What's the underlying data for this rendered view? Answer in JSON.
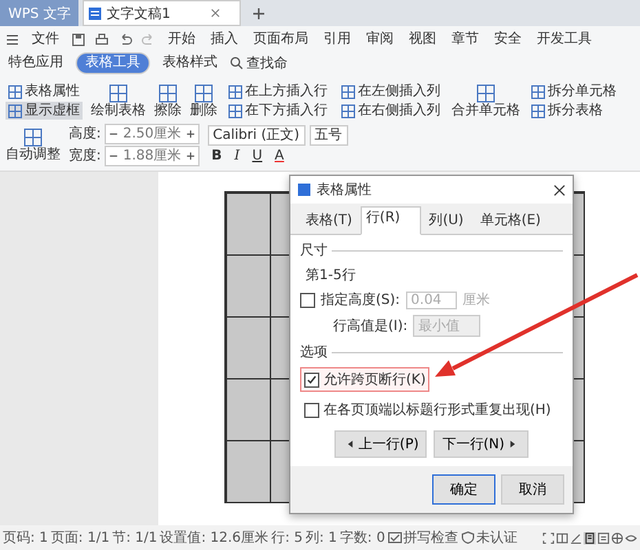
{
  "app_tabs": [
    {
      "label": "WPS 文字",
      "selected": false
    },
    {
      "label": "文字文稿1",
      "selected": true
    }
  ],
  "menu": [
    {
      "label": "文件",
      "selected": false
    },
    {
      "label": "开始",
      "selected": false
    },
    {
      "label": "插入",
      "selected": false
    },
    {
      "label": "页面布局",
      "selected": false
    },
    {
      "label": "引用",
      "selected": false
    },
    {
      "label": "审阅",
      "selected": false
    },
    {
      "label": "视图",
      "selected": false
    },
    {
      "label": "章节",
      "selected": false
    },
    {
      "label": "安全",
      "selected": false
    },
    {
      "label": "开发工具",
      "selected": false
    },
    {
      "label": "特色应用",
      "selected": false
    },
    {
      "label": "表格工具",
      "selected": true
    },
    {
      "label": "表格样式",
      "selected": false
    }
  ],
  "search": {
    "label": "查找命"
  },
  "ribbon": [
    {
      "kind": "stack",
      "items": [
        {
          "label": "表格属性",
          "on": false
        },
        {
          "label": "显示虚框",
          "on": true
        }
      ]
    },
    {
      "kind": "large",
      "label": "绘制表格"
    },
    {
      "kind": "large",
      "label": "擦除"
    },
    {
      "kind": "large",
      "label": "删除"
    },
    {
      "kind": "stack",
      "items": [
        {
          "label": "在上方插入行",
          "on": false
        },
        {
          "label": "在下方插入行",
          "on": false
        }
      ]
    },
    {
      "kind": "stack",
      "items": [
        {
          "label": "在左侧插入列",
          "on": false
        },
        {
          "label": "在右侧插入列",
          "on": false
        }
      ]
    },
    {
      "kind": "large",
      "label": "合并单元格"
    },
    {
      "kind": "stack",
      "items": [
        {
          "label": "拆分单元格",
          "on": false
        },
        {
          "label": "拆分表格",
          "on": false
        }
      ]
    },
    {
      "kind": "large",
      "label": "自动调整"
    },
    {
      "kind": "spins",
      "items": [
        {
          "label": "高度:",
          "value": "2.50厘米"
        },
        {
          "label": "宽度:",
          "value": "1.88厘米"
        }
      ]
    },
    {
      "kind": "font",
      "font": "Calibri (正文)",
      "size": "五号",
      "format": [
        "B",
        "I",
        "U",
        "A"
      ]
    }
  ],
  "dialog": {
    "title": "表格属性",
    "tabs": [
      {
        "label": "表格(T)",
        "selected": false
      },
      {
        "label": "行(R)",
        "selected": true
      },
      {
        "label": "列(U)",
        "selected": false
      },
      {
        "label": "单元格(E)",
        "selected": false
      }
    ],
    "size_section": "尺寸",
    "row_range": "第1-5行",
    "height": {
      "label": "指定高度(S):",
      "checked": false,
      "value": "0.04",
      "unit": "厘米",
      "disabled": true
    },
    "row_height_type": {
      "label": "行高值是(I):",
      "value": "最小值",
      "disabled": true
    },
    "options_section": "选项",
    "options": [
      {
        "label": "允许跨页断行(K)",
        "checked": true,
        "highlighted": true
      },
      {
        "label": "在各页顶端以标题行形式重复出现(H)",
        "checked": false,
        "highlighted": false
      }
    ],
    "nav": [
      "上一行(P)",
      "下一行(N)"
    ],
    "buttons": [
      {
        "label": "确定",
        "selected": true
      },
      {
        "label": "取消",
        "selected": false
      }
    ]
  },
  "status_bar": [
    {
      "label": "页码: 1",
      "kind": "text"
    },
    {
      "label": "页面: 1/1",
      "kind": "text"
    },
    {
      "label": "节: 1/1",
      "kind": "text"
    },
    {
      "label": "设置值: 12.6厘米",
      "kind": "text"
    },
    {
      "label": "行: 5",
      "kind": "text"
    },
    {
      "label": "列: 1",
      "kind": "text"
    },
    {
      "label": "字数: 0",
      "kind": "text"
    },
    {
      "label": "拼写检查",
      "kind": "check"
    },
    {
      "label": "未认证",
      "kind": "shield"
    }
  ]
}
